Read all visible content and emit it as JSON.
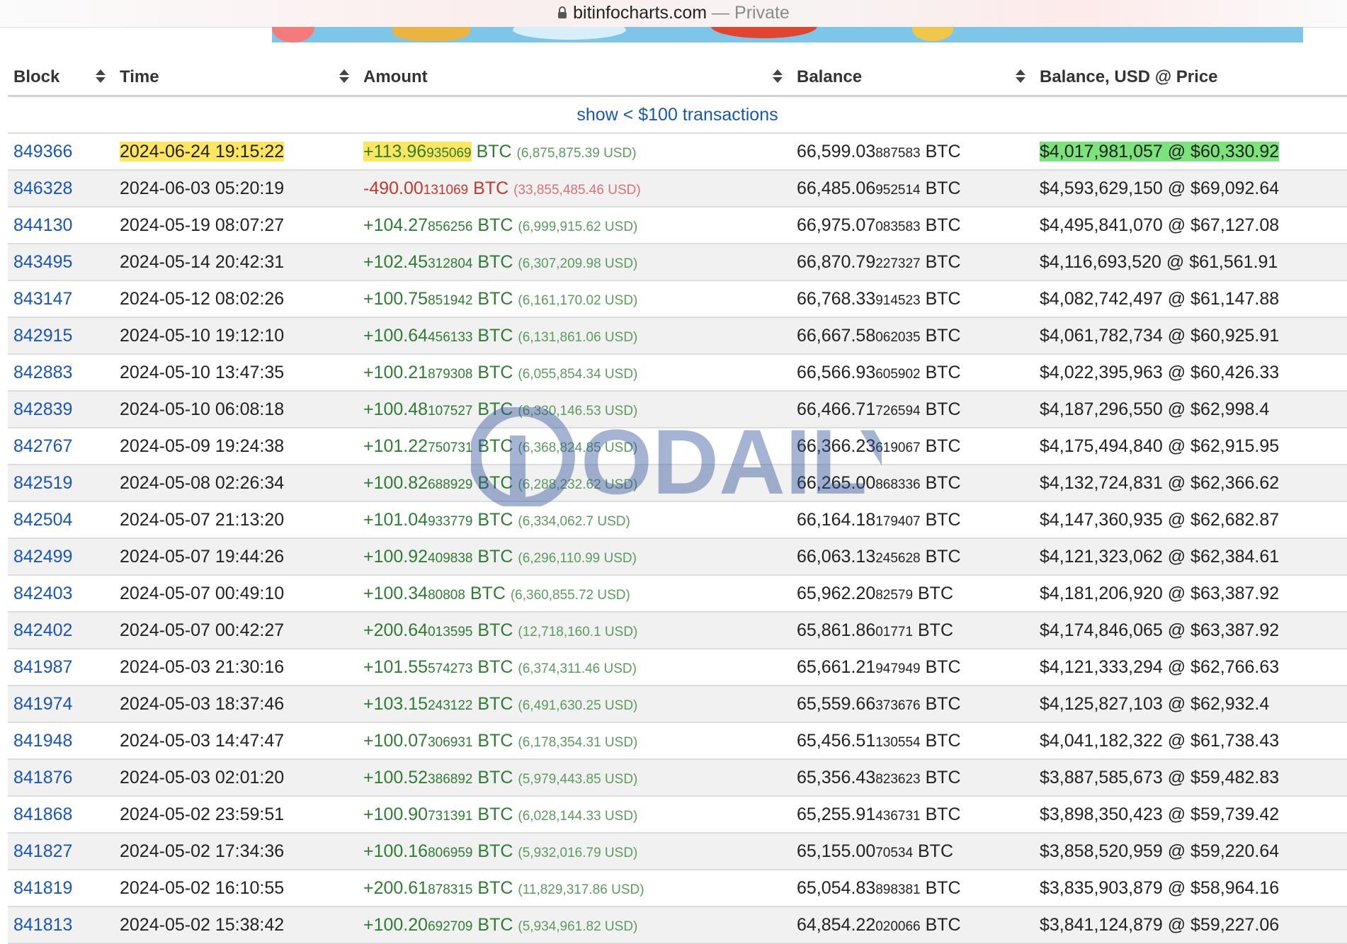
{
  "browser": {
    "domain": "bitinfocharts.com",
    "separator": " — ",
    "mode": "Private"
  },
  "table": {
    "headers": [
      "Block",
      "Time",
      "Amount",
      "Balance",
      "Balance, USD @ Price"
    ],
    "show_link": "show < $100 transactions",
    "rows": [
      {
        "block": "849366",
        "time": "2024-06-24 19:15:22",
        "amt_main": "+113.96",
        "amt_dec": "935069",
        "unit": " BTC ",
        "usd": "(6,875,875.39 USD)",
        "bal_main": "66,599.03",
        "bal_dec": "887583",
        "bal_unit": " BTC",
        "bal_usd": "$4,017,981,057 @ $60,330.92",
        "type": "in"
      },
      {
        "block": "846328",
        "time": "2024-06-03 05:20:19",
        "amt_main": "-490.00",
        "amt_dec": "131069",
        "unit": " BTC ",
        "usd": "(33,855,485.46 USD)",
        "bal_main": "66,485.06",
        "bal_dec": "952514",
        "bal_unit": " BTC",
        "bal_usd": "$4,593,629,150 @ $69,092.64",
        "type": "out"
      },
      {
        "block": "844130",
        "time": "2024-05-19 08:07:27",
        "amt_main": "+104.27",
        "amt_dec": "856256",
        "unit": " BTC ",
        "usd": "(6,999,915.62 USD)",
        "bal_main": "66,975.07",
        "bal_dec": "083583",
        "bal_unit": " BTC",
        "bal_usd": "$4,495,841,070 @ $67,127.08",
        "type": "in"
      },
      {
        "block": "843495",
        "time": "2024-05-14 20:42:31",
        "amt_main": "+102.45",
        "amt_dec": "312804",
        "unit": " BTC ",
        "usd": "(6,307,209.98 USD)",
        "bal_main": "66,870.79",
        "bal_dec": "227327",
        "bal_unit": " BTC",
        "bal_usd": "$4,116,693,520 @ $61,561.91",
        "type": "in"
      },
      {
        "block": "843147",
        "time": "2024-05-12 08:02:26",
        "amt_main": "+100.75",
        "amt_dec": "851942",
        "unit": " BTC ",
        "usd": "(6,161,170.02 USD)",
        "bal_main": "66,768.33",
        "bal_dec": "914523",
        "bal_unit": " BTC",
        "bal_usd": "$4,082,742,497 @ $61,147.88",
        "type": "in"
      },
      {
        "block": "842915",
        "time": "2024-05-10 19:12:10",
        "amt_main": "+100.64",
        "amt_dec": "456133",
        "unit": " BTC ",
        "usd": "(6,131,861.06 USD)",
        "bal_main": "66,667.58",
        "bal_dec": "062035",
        "bal_unit": " BTC",
        "bal_usd": "$4,061,782,734 @ $60,925.91",
        "type": "in"
      },
      {
        "block": "842883",
        "time": "2024-05-10 13:47:35",
        "amt_main": "+100.21",
        "amt_dec": "879308",
        "unit": " BTC ",
        "usd": "(6,055,854.34 USD)",
        "bal_main": "66,566.93",
        "bal_dec": "605902",
        "bal_unit": " BTC",
        "bal_usd": "$4,022,395,963 @ $60,426.33",
        "type": "in"
      },
      {
        "block": "842839",
        "time": "2024-05-10 06:08:18",
        "amt_main": "+100.48",
        "amt_dec": "107527",
        "unit": " BTC ",
        "usd": "(6,330,146.53 USD)",
        "bal_main": "66,466.71",
        "bal_dec": "726594",
        "bal_unit": " BTC",
        "bal_usd": "$4,187,296,550 @ $62,998.4",
        "type": "in"
      },
      {
        "block": "842767",
        "time": "2024-05-09 19:24:38",
        "amt_main": "+101.22",
        "amt_dec": "750731",
        "unit": " BTC ",
        "usd": "(6,368,824.85 USD)",
        "bal_main": "66,366.23",
        "bal_dec": "619067",
        "bal_unit": " BTC",
        "bal_usd": "$4,175,494,840 @ $62,915.95",
        "type": "in"
      },
      {
        "block": "842519",
        "time": "2024-05-08 02:26:34",
        "amt_main": "+100.82",
        "amt_dec": "688929",
        "unit": " BTC ",
        "usd": "(6,288,232.62 USD)",
        "bal_main": "66,265.00",
        "bal_dec": "868336",
        "bal_unit": " BTC",
        "bal_usd": "$4,132,724,831 @ $62,366.62",
        "type": "in"
      },
      {
        "block": "842504",
        "time": "2024-05-07 21:13:20",
        "amt_main": "+101.04",
        "amt_dec": "933779",
        "unit": " BTC ",
        "usd": "(6,334,062.7 USD)",
        "bal_main": "66,164.18",
        "bal_dec": "179407",
        "bal_unit": " BTC",
        "bal_usd": "$4,147,360,935 @ $62,682.87",
        "type": "in"
      },
      {
        "block": "842499",
        "time": "2024-05-07 19:44:26",
        "amt_main": "+100.92",
        "amt_dec": "409838",
        "unit": " BTC ",
        "usd": "(6,296,110.99 USD)",
        "bal_main": "66,063.13",
        "bal_dec": "245628",
        "bal_unit": " BTC",
        "bal_usd": "$4,121,323,062 @ $62,384.61",
        "type": "in"
      },
      {
        "block": "842403",
        "time": "2024-05-07 00:49:10",
        "amt_main": "+100.34",
        "amt_dec": "80808",
        "unit": " BTC ",
        "usd": "(6,360,855.72 USD)",
        "bal_main": "65,962.20",
        "bal_dec": "82579",
        "bal_unit": " BTC",
        "bal_usd": "$4,181,206,920 @ $63,387.92",
        "type": "in"
      },
      {
        "block": "842402",
        "time": "2024-05-07 00:42:27",
        "amt_main": "+200.64",
        "amt_dec": "013595",
        "unit": " BTC ",
        "usd": "(12,718,160.1 USD)",
        "bal_main": "65,861.86",
        "bal_dec": "01771",
        "bal_unit": " BTC",
        "bal_usd": "$4,174,846,065 @ $63,387.92",
        "type": "in"
      },
      {
        "block": "841987",
        "time": "2024-05-03 21:30:16",
        "amt_main": "+101.55",
        "amt_dec": "574273",
        "unit": " BTC ",
        "usd": "(6,374,311.46 USD)",
        "bal_main": "65,661.21",
        "bal_dec": "947949",
        "bal_unit": " BTC",
        "bal_usd": "$4,121,333,294 @ $62,766.63",
        "type": "in"
      },
      {
        "block": "841974",
        "time": "2024-05-03 18:37:46",
        "amt_main": "+103.15",
        "amt_dec": "243122",
        "unit": " BTC ",
        "usd": "(6,491,630.25 USD)",
        "bal_main": "65,559.66",
        "bal_dec": "373676",
        "bal_unit": " BTC",
        "bal_usd": "$4,125,827,103 @ $62,932.4",
        "type": "in"
      },
      {
        "block": "841948",
        "time": "2024-05-03 14:47:47",
        "amt_main": "+100.07",
        "amt_dec": "306931",
        "unit": " BTC ",
        "usd": "(6,178,354.31 USD)",
        "bal_main": "65,456.51",
        "bal_dec": "130554",
        "bal_unit": " BTC",
        "bal_usd": "$4,041,182,322 @ $61,738.43",
        "type": "in"
      },
      {
        "block": "841876",
        "time": "2024-05-03 02:01:20",
        "amt_main": "+100.52",
        "amt_dec": "386892",
        "unit": " BTC ",
        "usd": "(5,979,443.85 USD)",
        "bal_main": "65,356.43",
        "bal_dec": "823623",
        "bal_unit": " BTC",
        "bal_usd": "$3,887,585,673 @ $59,482.83",
        "type": "in"
      },
      {
        "block": "841868",
        "time": "2024-05-02 23:59:51",
        "amt_main": "+100.90",
        "amt_dec": "731391",
        "unit": " BTC ",
        "usd": "(6,028,144.33 USD)",
        "bal_main": "65,255.91",
        "bal_dec": "436731",
        "bal_unit": " BTC",
        "bal_usd": "$3,898,350,423 @ $59,739.42",
        "type": "in"
      },
      {
        "block": "841827",
        "time": "2024-05-02 17:34:36",
        "amt_main": "+100.16",
        "amt_dec": "806959",
        "unit": " BTC ",
        "usd": "(5,932,016.79 USD)",
        "bal_main": "65,155.00",
        "bal_dec": "70534",
        "bal_unit": " BTC",
        "bal_usd": "$3,858,520,959 @ $59,220.64",
        "type": "in"
      },
      {
        "block": "841819",
        "time": "2024-05-02 16:10:55",
        "amt_main": "+200.61",
        "amt_dec": "878315",
        "unit": " BTC ",
        "usd": "(11,829,317.86 USD)",
        "bal_main": "65,054.83",
        "bal_dec": "898381",
        "bal_unit": " BTC",
        "bal_usd": "$3,835,903,879 @ $58,964.16",
        "type": "in"
      },
      {
        "block": "841813",
        "time": "2024-05-02 15:38:42",
        "amt_main": "+100.20",
        "amt_dec": "692709",
        "unit": " BTC ",
        "usd": "(5,934,961.82 USD)",
        "bal_main": "64,854.22",
        "bal_dec": "020066",
        "bal_unit": " BTC",
        "bal_usd": "$3,841,124,879 @ $59,227.06",
        "type": "in"
      }
    ]
  },
  "watermark": {
    "text": "ODAILY"
  },
  "colors": {
    "link": "#1a56b0",
    "incoming": "#2e7d32",
    "outgoing": "#c0392b",
    "highlight_yellow": "#ffd600",
    "highlight_green": "#44d644"
  }
}
